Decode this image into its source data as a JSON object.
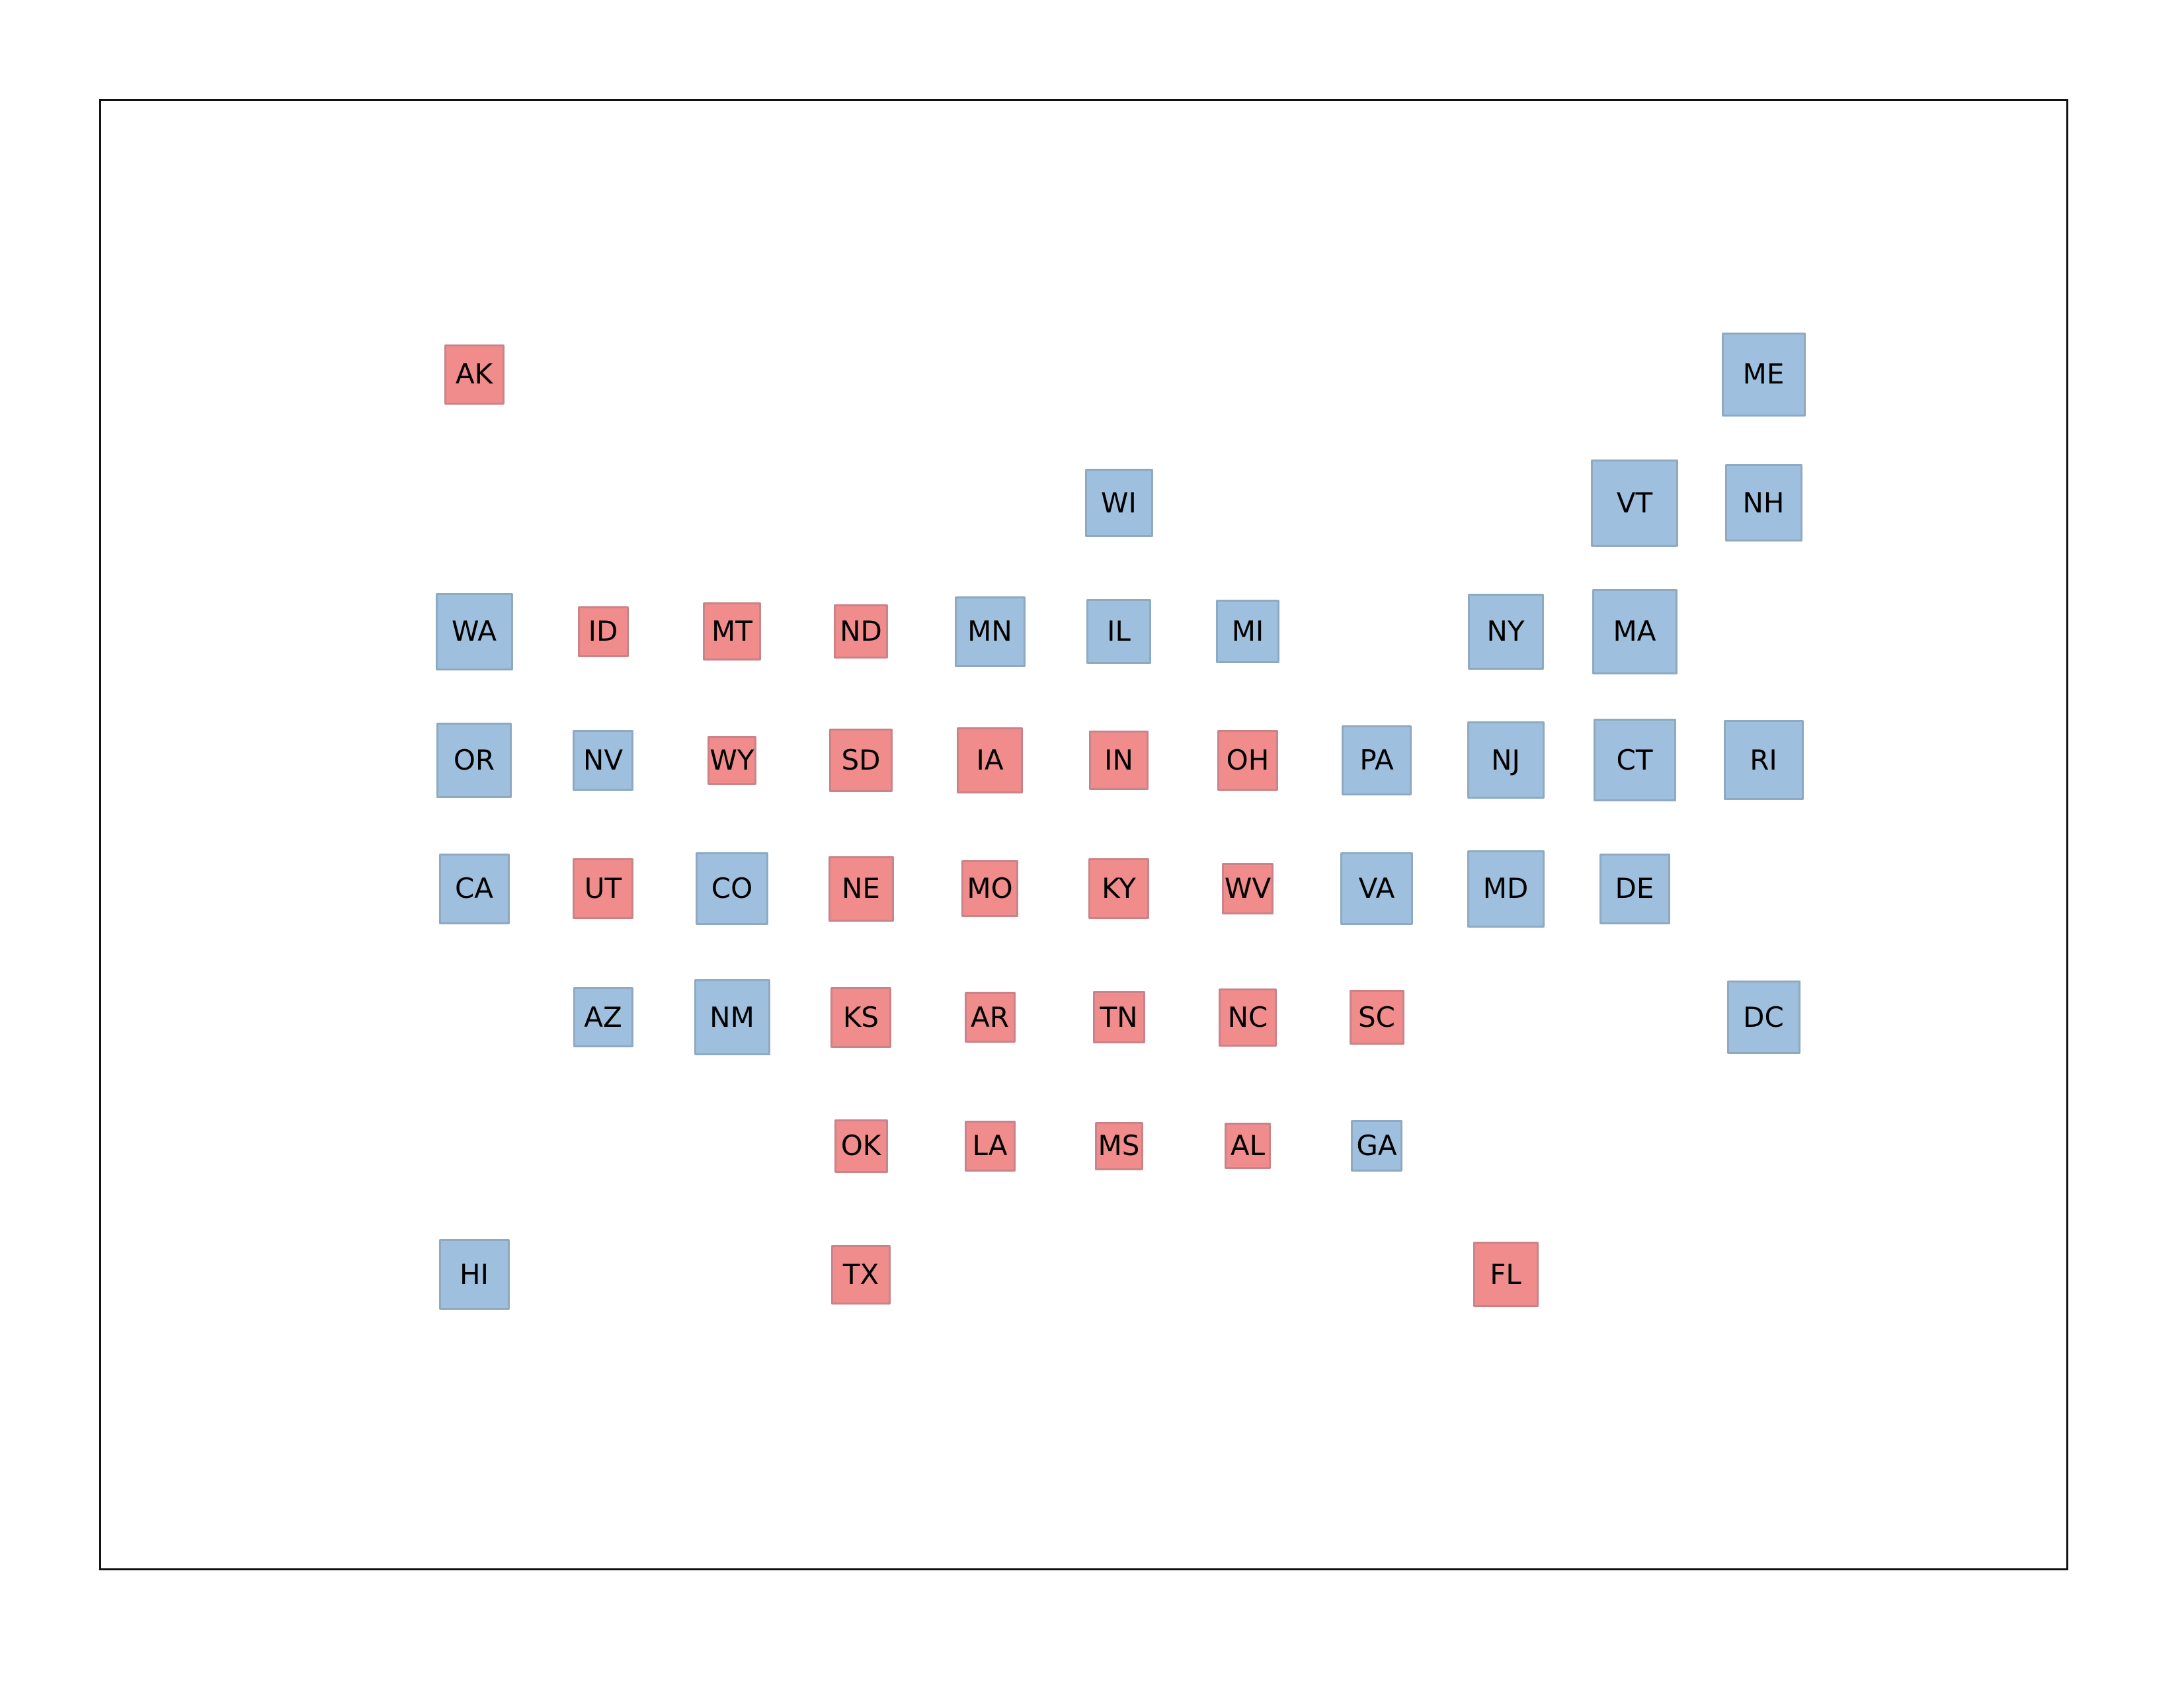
{
  "map": {
    "type": "tile-grid-map",
    "grid": {
      "columns": 11,
      "rows": 8
    },
    "colors": {
      "dem": {
        "fill": "#9ebfdd",
        "border": "#8ea9c1"
      },
      "rep": {
        "fill": "#f08c8c",
        "border": "#c98389"
      },
      "label": "#000000",
      "frame": "#111111"
    },
    "size_note": "relative tile magnitude, fraction of largest tile",
    "tiles": [
      {
        "state": "AK",
        "col": 0,
        "row": 0,
        "party": "rep",
        "magnitude": 0.69
      },
      {
        "state": "ME",
        "col": 10,
        "row": 0,
        "party": "dem",
        "magnitude": 0.96
      },
      {
        "state": "WI",
        "col": 5,
        "row": 1,
        "party": "dem",
        "magnitude": 0.78
      },
      {
        "state": "VT",
        "col": 9,
        "row": 1,
        "party": "dem",
        "magnitude": 1.0
      },
      {
        "state": "NH",
        "col": 10,
        "row": 1,
        "party": "dem",
        "magnitude": 0.89
      },
      {
        "state": "WA",
        "col": 0,
        "row": 2,
        "party": "dem",
        "magnitude": 0.89
      },
      {
        "state": "ID",
        "col": 1,
        "row": 2,
        "party": "rep",
        "magnitude": 0.58
      },
      {
        "state": "MT",
        "col": 2,
        "row": 2,
        "party": "rep",
        "magnitude": 0.67
      },
      {
        "state": "ND",
        "col": 3,
        "row": 2,
        "party": "rep",
        "magnitude": 0.62
      },
      {
        "state": "MN",
        "col": 4,
        "row": 2,
        "party": "dem",
        "magnitude": 0.81
      },
      {
        "state": "IL",
        "col": 5,
        "row": 2,
        "party": "dem",
        "magnitude": 0.74
      },
      {
        "state": "MI",
        "col": 6,
        "row": 2,
        "party": "dem",
        "magnitude": 0.73
      },
      {
        "state": "NY",
        "col": 8,
        "row": 2,
        "party": "dem",
        "magnitude": 0.87
      },
      {
        "state": "MA",
        "col": 9,
        "row": 2,
        "party": "dem",
        "magnitude": 0.98
      },
      {
        "state": "OR",
        "col": 0,
        "row": 3,
        "party": "dem",
        "magnitude": 0.86
      },
      {
        "state": "NV",
        "col": 1,
        "row": 3,
        "party": "dem",
        "magnitude": 0.7
      },
      {
        "state": "WY",
        "col": 2,
        "row": 3,
        "party": "rep",
        "magnitude": 0.56
      },
      {
        "state": "SD",
        "col": 3,
        "row": 3,
        "party": "rep",
        "magnitude": 0.73
      },
      {
        "state": "IA",
        "col": 4,
        "row": 3,
        "party": "rep",
        "magnitude": 0.76
      },
      {
        "state": "IN",
        "col": 5,
        "row": 3,
        "party": "rep",
        "magnitude": 0.68
      },
      {
        "state": "OH",
        "col": 6,
        "row": 3,
        "party": "rep",
        "magnitude": 0.7
      },
      {
        "state": "PA",
        "col": 7,
        "row": 3,
        "party": "dem",
        "magnitude": 0.8
      },
      {
        "state": "NJ",
        "col": 8,
        "row": 3,
        "party": "dem",
        "magnitude": 0.89
      },
      {
        "state": "CT",
        "col": 9,
        "row": 3,
        "party": "dem",
        "magnitude": 0.95
      },
      {
        "state": "RI",
        "col": 10,
        "row": 3,
        "party": "dem",
        "magnitude": 0.92
      },
      {
        "state": "CA",
        "col": 0,
        "row": 4,
        "party": "dem",
        "magnitude": 0.81
      },
      {
        "state": "UT",
        "col": 1,
        "row": 4,
        "party": "rep",
        "magnitude": 0.7
      },
      {
        "state": "CO",
        "col": 2,
        "row": 4,
        "party": "dem",
        "magnitude": 0.83
      },
      {
        "state": "NE",
        "col": 3,
        "row": 4,
        "party": "rep",
        "magnitude": 0.75
      },
      {
        "state": "MO",
        "col": 4,
        "row": 4,
        "party": "rep",
        "magnitude": 0.65
      },
      {
        "state": "KY",
        "col": 5,
        "row": 4,
        "party": "rep",
        "magnitude": 0.7
      },
      {
        "state": "WV",
        "col": 6,
        "row": 4,
        "party": "rep",
        "magnitude": 0.59
      },
      {
        "state": "VA",
        "col": 7,
        "row": 4,
        "party": "dem",
        "magnitude": 0.83
      },
      {
        "state": "MD",
        "col": 8,
        "row": 4,
        "party": "dem",
        "magnitude": 0.89
      },
      {
        "state": "DE",
        "col": 9,
        "row": 4,
        "party": "dem",
        "magnitude": 0.81
      },
      {
        "state": "AZ",
        "col": 1,
        "row": 5,
        "party": "dem",
        "magnitude": 0.69
      },
      {
        "state": "NM",
        "col": 2,
        "row": 5,
        "party": "dem",
        "magnitude": 0.87
      },
      {
        "state": "KS",
        "col": 3,
        "row": 5,
        "party": "rep",
        "magnitude": 0.7
      },
      {
        "state": "AR",
        "col": 4,
        "row": 5,
        "party": "rep",
        "magnitude": 0.58
      },
      {
        "state": "TN",
        "col": 5,
        "row": 5,
        "party": "rep",
        "magnitude": 0.6
      },
      {
        "state": "NC",
        "col": 6,
        "row": 5,
        "party": "rep",
        "magnitude": 0.67
      },
      {
        "state": "SC",
        "col": 7,
        "row": 5,
        "party": "rep",
        "magnitude": 0.63
      },
      {
        "state": "DC",
        "col": 10,
        "row": 5,
        "party": "dem",
        "magnitude": 0.84
      },
      {
        "state": "OK",
        "col": 3,
        "row": 6,
        "party": "rep",
        "magnitude": 0.61
      },
      {
        "state": "LA",
        "col": 4,
        "row": 6,
        "party": "rep",
        "magnitude": 0.58
      },
      {
        "state": "MS",
        "col": 5,
        "row": 6,
        "party": "rep",
        "magnitude": 0.55
      },
      {
        "state": "AL",
        "col": 6,
        "row": 6,
        "party": "rep",
        "magnitude": 0.53
      },
      {
        "state": "GA",
        "col": 7,
        "row": 6,
        "party": "dem",
        "magnitude": 0.59
      },
      {
        "state": "HI",
        "col": 0,
        "row": 7,
        "party": "dem",
        "magnitude": 0.81
      },
      {
        "state": "TX",
        "col": 3,
        "row": 7,
        "party": "rep",
        "magnitude": 0.68
      },
      {
        "state": "FL",
        "col": 8,
        "row": 7,
        "party": "rep",
        "magnitude": 0.75
      }
    ]
  }
}
